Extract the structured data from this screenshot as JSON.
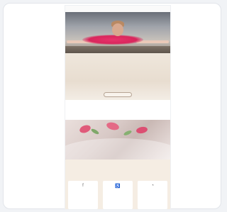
{
  "nav": {
    "items": [
      "",
      "",
      "",
      "",
      "",
      "",
      "",
      ""
    ]
  },
  "intro": {
    "kicker": "",
    "title": "",
    "subtitle": "",
    "paragraph": "",
    "button_label": ""
  },
  "stats": [
    {
      "number": "",
      "label": ""
    },
    {
      "number": "",
      "label": ""
    },
    {
      "number": "",
      "label": ""
    }
  ],
  "features": {
    "heading": "",
    "description": "",
    "cards": [
      {
        "icon": "facebook-icon",
        "title": "",
        "text": ""
      },
      {
        "icon": "accessibility-icon",
        "title": "",
        "text": ""
      },
      {
        "icon": "gauge-icon",
        "title": "",
        "text": ""
      }
    ]
  },
  "colors": {
    "accent": "#d9265c",
    "cream": "#f5ede3",
    "text_gold": "#a9906f"
  }
}
